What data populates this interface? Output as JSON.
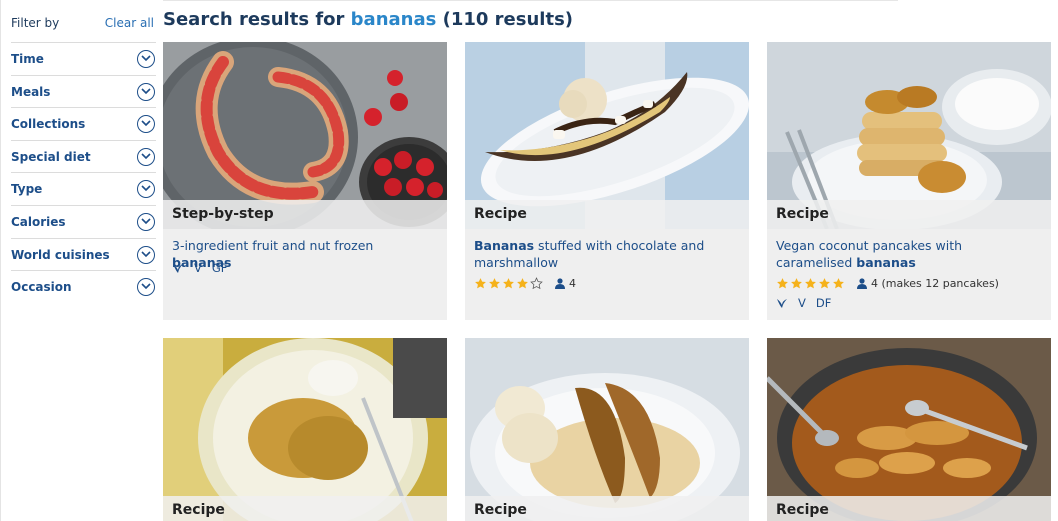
{
  "filters": {
    "heading": "Filter by",
    "clear_label": "Clear all",
    "items": [
      {
        "label": "Time"
      },
      {
        "label": "Meals"
      },
      {
        "label": "Collections"
      },
      {
        "label": "Special diet"
      },
      {
        "label": "Type"
      },
      {
        "label": "Calories"
      },
      {
        "label": "World cuisines"
      },
      {
        "label": "Occasion"
      }
    ]
  },
  "search": {
    "prefix": "Search results for ",
    "term": "bananas",
    "count": "(110 results)"
  },
  "cards": [
    {
      "type": "Step-by-step",
      "title_pre": "3-ingredient fruit and nut frozen ",
      "title_bold": "bananas",
      "title_post": "",
      "diet": [
        "V",
        "GF"
      ],
      "vegan_icon": "vegan-leaf-icon"
    },
    {
      "type": "Recipe",
      "title_pre": "",
      "title_bold": "Bananas",
      "title_post": " stuffed with chocolate and marshmallow",
      "rating": 4,
      "servings": "4"
    },
    {
      "type": "Recipe",
      "title_pre": "Vegan coconut pancakes with caramelised ",
      "title_bold": "bananas",
      "title_post": "",
      "rating": 5,
      "servings": "4 (makes 12 pancakes)",
      "diet": [
        "V",
        "DF"
      ],
      "vegan_icon": "vegan-leaf-icon"
    },
    {
      "type": "Recipe"
    },
    {
      "type": "Recipe"
    },
    {
      "type": "Recipe"
    }
  ],
  "colors": {
    "accent": "#2a86c9",
    "link": "#1d4e89",
    "star": "#f5b21b",
    "card_bg": "#efefef"
  }
}
